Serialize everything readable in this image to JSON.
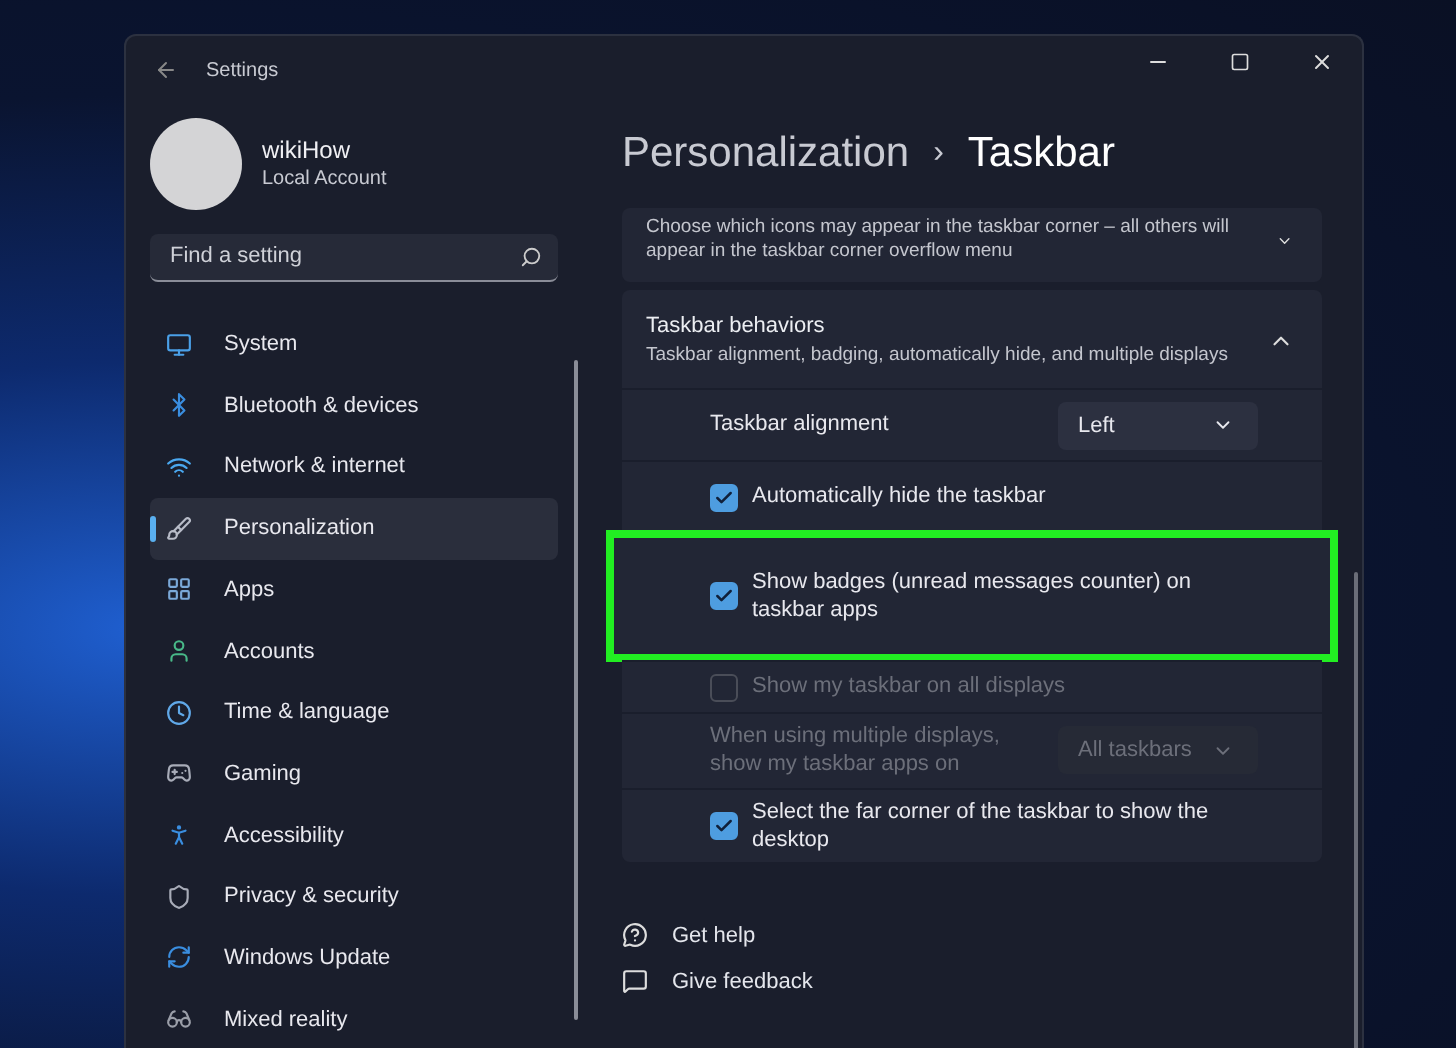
{
  "window": {
    "title": "Settings"
  },
  "account": {
    "name": "wikiHow",
    "type": "Local Account"
  },
  "search": {
    "placeholder": "Find a setting"
  },
  "sidebar": {
    "items": [
      {
        "label": "System",
        "selected": false
      },
      {
        "label": "Bluetooth & devices",
        "selected": false
      },
      {
        "label": "Network & internet",
        "selected": false
      },
      {
        "label": "Personalization",
        "selected": true
      },
      {
        "label": "Apps",
        "selected": false
      },
      {
        "label": "Accounts",
        "selected": false
      },
      {
        "label": "Time & language",
        "selected": false
      },
      {
        "label": "Gaming",
        "selected": false
      },
      {
        "label": "Accessibility",
        "selected": false
      },
      {
        "label": "Privacy & security",
        "selected": false
      },
      {
        "label": "Windows Update",
        "selected": false
      },
      {
        "label": "Mixed reality",
        "selected": false
      }
    ]
  },
  "breadcrumb": {
    "parent": "Personalization",
    "separator": "›",
    "current": "Taskbar"
  },
  "sections": [
    {
      "description": "Choose which icons may appear in the taskbar corner – all others will appear in the taskbar corner overflow menu",
      "expanded": false
    },
    {
      "title": "Taskbar behaviors",
      "description": "Taskbar alignment, badging, automatically hide, and multiple displays",
      "expanded": true,
      "rows": [
        {
          "kind": "dropdown",
          "label": "Taskbar alignment",
          "value": "Left",
          "disabled": false,
          "highlighted": false
        },
        {
          "kind": "checkbox",
          "label": "Automatically hide the taskbar",
          "checked": true,
          "disabled": false,
          "highlighted": false
        },
        {
          "kind": "checkbox",
          "label": "Show badges (unread messages counter) on taskbar apps",
          "checked": true,
          "disabled": false,
          "highlighted": true
        },
        {
          "kind": "checkbox",
          "label": "Show my taskbar on all displays",
          "checked": false,
          "disabled": true,
          "highlighted": false
        },
        {
          "kind": "dropdown",
          "label": "When using multiple displays, show my taskbar apps on",
          "value": "All taskbars",
          "disabled": true,
          "highlighted": false
        },
        {
          "kind": "checkbox",
          "label": "Select the far corner of the taskbar to show the desktop",
          "checked": true,
          "disabled": false,
          "highlighted": false
        }
      ]
    }
  ],
  "footer_links": [
    "Get help",
    "Give feedback"
  ]
}
